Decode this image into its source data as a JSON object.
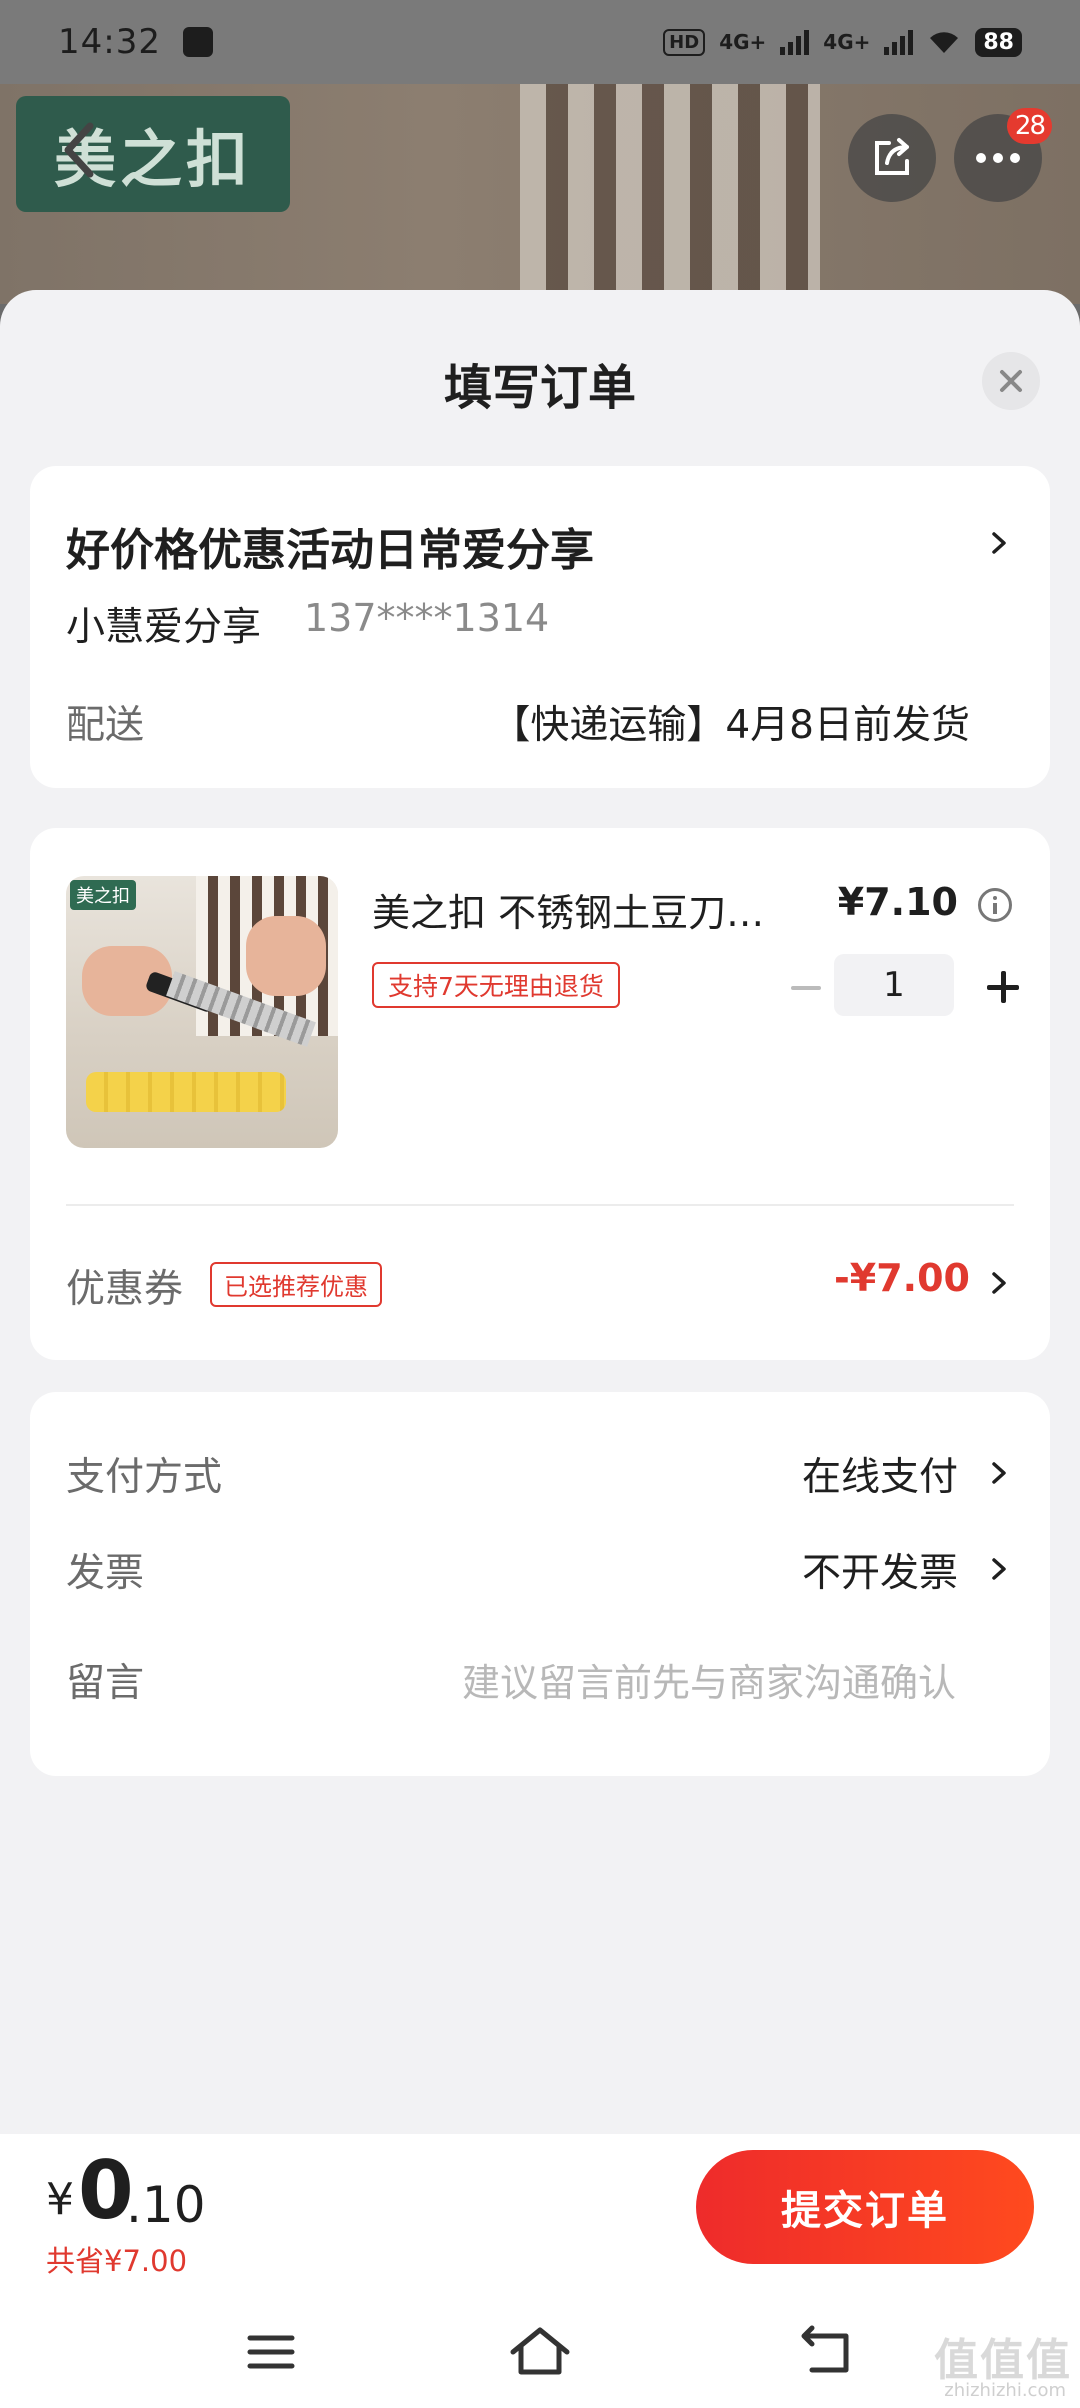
{
  "status_bar": {
    "time": "14:32",
    "hd_label": "HD",
    "network_1": "4G+",
    "network_2": "4G+",
    "battery": "88"
  },
  "hero": {
    "brand_logo_text": "美之扣",
    "more_badge": "28"
  },
  "sheet": {
    "title": "填写订单"
  },
  "address": {
    "title": "好价格优惠活动日常爱分享",
    "name": "小慧爱分享",
    "phone": "137****1314",
    "delivery_label": "配送",
    "delivery_value": "【快递运输】4月8日前发货"
  },
  "goods": {
    "image_logo_text": "美之扣",
    "name": "美之扣 不锈钢土豆刀…",
    "price": "¥7.10",
    "return_tag": "支持7天无理由退货",
    "quantity": "1",
    "coupon_label": "优惠券",
    "coupon_tag": "已选推荐优惠",
    "coupon_value": "-¥7.00"
  },
  "payment": {
    "method_label": "支付方式",
    "method_value": "在线支付",
    "invoice_label": "发票",
    "invoice_value": "不开发票",
    "note_label": "留言",
    "note_placeholder": "建议留言前先与商家沟通确认"
  },
  "footer": {
    "currency": "¥",
    "total_int": "0",
    "total_dec": ".10",
    "saved": "共省¥7.00",
    "submit_label": "提交订单"
  },
  "watermark": {
    "text": "值值值",
    "sub": "zhizhizhi.com"
  },
  "colors": {
    "accent": "#e0392f",
    "submit_start": "#ee2b2b",
    "submit_end": "#ff4a1e"
  }
}
